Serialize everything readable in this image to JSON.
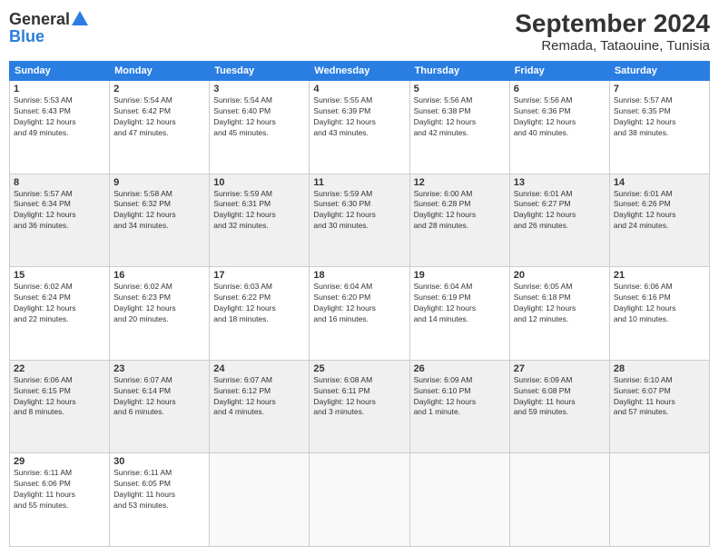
{
  "header": {
    "logo_line1": "General",
    "logo_line2": "Blue",
    "month_title": "September 2024",
    "location": "Remada, Tataouine, Tunisia"
  },
  "weekdays": [
    "Sunday",
    "Monday",
    "Tuesday",
    "Wednesday",
    "Thursday",
    "Friday",
    "Saturday"
  ],
  "weeks": [
    [
      {
        "day": "1",
        "info": "Sunrise: 5:53 AM\nSunset: 6:43 PM\nDaylight: 12 hours\nand 49 minutes."
      },
      {
        "day": "2",
        "info": "Sunrise: 5:54 AM\nSunset: 6:42 PM\nDaylight: 12 hours\nand 47 minutes."
      },
      {
        "day": "3",
        "info": "Sunrise: 5:54 AM\nSunset: 6:40 PM\nDaylight: 12 hours\nand 45 minutes."
      },
      {
        "day": "4",
        "info": "Sunrise: 5:55 AM\nSunset: 6:39 PM\nDaylight: 12 hours\nand 43 minutes."
      },
      {
        "day": "5",
        "info": "Sunrise: 5:56 AM\nSunset: 6:38 PM\nDaylight: 12 hours\nand 42 minutes."
      },
      {
        "day": "6",
        "info": "Sunrise: 5:56 AM\nSunset: 6:36 PM\nDaylight: 12 hours\nand 40 minutes."
      },
      {
        "day": "7",
        "info": "Sunrise: 5:57 AM\nSunset: 6:35 PM\nDaylight: 12 hours\nand 38 minutes."
      }
    ],
    [
      {
        "day": "8",
        "info": "Sunrise: 5:57 AM\nSunset: 6:34 PM\nDaylight: 12 hours\nand 36 minutes."
      },
      {
        "day": "9",
        "info": "Sunrise: 5:58 AM\nSunset: 6:32 PM\nDaylight: 12 hours\nand 34 minutes."
      },
      {
        "day": "10",
        "info": "Sunrise: 5:59 AM\nSunset: 6:31 PM\nDaylight: 12 hours\nand 32 minutes."
      },
      {
        "day": "11",
        "info": "Sunrise: 5:59 AM\nSunset: 6:30 PM\nDaylight: 12 hours\nand 30 minutes."
      },
      {
        "day": "12",
        "info": "Sunrise: 6:00 AM\nSunset: 6:28 PM\nDaylight: 12 hours\nand 28 minutes."
      },
      {
        "day": "13",
        "info": "Sunrise: 6:01 AM\nSunset: 6:27 PM\nDaylight: 12 hours\nand 26 minutes."
      },
      {
        "day": "14",
        "info": "Sunrise: 6:01 AM\nSunset: 6:26 PM\nDaylight: 12 hours\nand 24 minutes."
      }
    ],
    [
      {
        "day": "15",
        "info": "Sunrise: 6:02 AM\nSunset: 6:24 PM\nDaylight: 12 hours\nand 22 minutes."
      },
      {
        "day": "16",
        "info": "Sunrise: 6:02 AM\nSunset: 6:23 PM\nDaylight: 12 hours\nand 20 minutes."
      },
      {
        "day": "17",
        "info": "Sunrise: 6:03 AM\nSunset: 6:22 PM\nDaylight: 12 hours\nand 18 minutes."
      },
      {
        "day": "18",
        "info": "Sunrise: 6:04 AM\nSunset: 6:20 PM\nDaylight: 12 hours\nand 16 minutes."
      },
      {
        "day": "19",
        "info": "Sunrise: 6:04 AM\nSunset: 6:19 PM\nDaylight: 12 hours\nand 14 minutes."
      },
      {
        "day": "20",
        "info": "Sunrise: 6:05 AM\nSunset: 6:18 PM\nDaylight: 12 hours\nand 12 minutes."
      },
      {
        "day": "21",
        "info": "Sunrise: 6:06 AM\nSunset: 6:16 PM\nDaylight: 12 hours\nand 10 minutes."
      }
    ],
    [
      {
        "day": "22",
        "info": "Sunrise: 6:06 AM\nSunset: 6:15 PM\nDaylight: 12 hours\nand 8 minutes."
      },
      {
        "day": "23",
        "info": "Sunrise: 6:07 AM\nSunset: 6:14 PM\nDaylight: 12 hours\nand 6 minutes."
      },
      {
        "day": "24",
        "info": "Sunrise: 6:07 AM\nSunset: 6:12 PM\nDaylight: 12 hours\nand 4 minutes."
      },
      {
        "day": "25",
        "info": "Sunrise: 6:08 AM\nSunset: 6:11 PM\nDaylight: 12 hours\nand 3 minutes."
      },
      {
        "day": "26",
        "info": "Sunrise: 6:09 AM\nSunset: 6:10 PM\nDaylight: 12 hours\nand 1 minute."
      },
      {
        "day": "27",
        "info": "Sunrise: 6:09 AM\nSunset: 6:08 PM\nDaylight: 11 hours\nand 59 minutes."
      },
      {
        "day": "28",
        "info": "Sunrise: 6:10 AM\nSunset: 6:07 PM\nDaylight: 11 hours\nand 57 minutes."
      }
    ],
    [
      {
        "day": "29",
        "info": "Sunrise: 6:11 AM\nSunset: 6:06 PM\nDaylight: 11 hours\nand 55 minutes."
      },
      {
        "day": "30",
        "info": "Sunrise: 6:11 AM\nSunset: 6:05 PM\nDaylight: 11 hours\nand 53 minutes."
      },
      {
        "day": "",
        "info": ""
      },
      {
        "day": "",
        "info": ""
      },
      {
        "day": "",
        "info": ""
      },
      {
        "day": "",
        "info": ""
      },
      {
        "day": "",
        "info": ""
      }
    ]
  ]
}
